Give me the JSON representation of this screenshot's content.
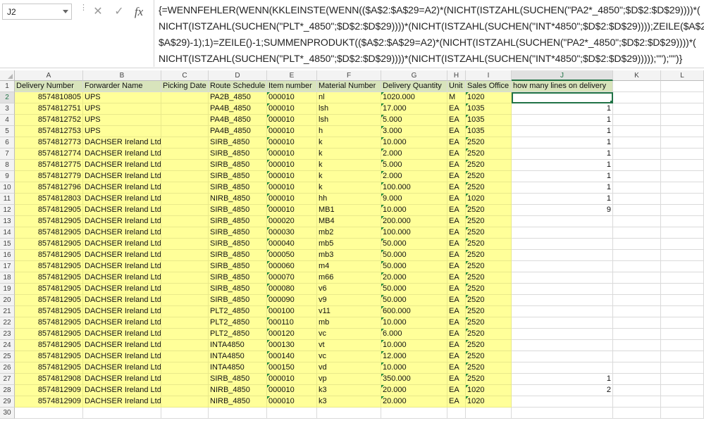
{
  "formula_bar": {
    "name_box": "J2",
    "cancel_symbol": "✕",
    "enter_symbol": "✓",
    "fx_label": "fx",
    "formula_lines": [
      "{=WENNFEHLER(WENN(KKLEINSTE(WENN(($A$2:$A$29=A2)*(NICHT(ISTZAHL(SUCHEN(\"PA2*_4850\";$D$2:$D$29))))*(",
      "NICHT(ISTZAHL(SUCHEN(\"PLT*_4850\";$D$2:$D$29))))*(NICHT(ISTZAHL(SUCHEN(\"INT*4850\";$D$2:$D$29))));ZEILE($A$2:",
      "$A$29)-1);1)=ZEILE()-1;SUMMENPRODUKT(($A$2:$A$29=A2)*(NICHT(ISTZAHL(SUCHEN(\"PA2*_4850\";$D$2:$D$29))))*(",
      "NICHT(ISTZAHL(SUCHEN(\"PLT*_4850\";$D$2:$D$29))))*(NICHT(ISTZAHL(SUCHEN(\"INT*4850\";$D$2:$D$29)))));\"\");\"\")}"
    ]
  },
  "columns": [
    "A",
    "B",
    "C",
    "D",
    "E",
    "F",
    "G",
    "H",
    "I",
    "J",
    "K",
    "L"
  ],
  "headers": [
    "Delivery Number",
    "Forwarder Name",
    "Picking Date",
    "Route Schedule",
    "Item number",
    "Material Number",
    "Delivery Quantity",
    "Unit",
    "Sales Office",
    "how many lines on delivery"
  ],
  "row_numbers": [
    "1",
    "2",
    "3",
    "4",
    "5",
    "6",
    "7",
    "8",
    "9",
    "10",
    "11",
    "12",
    "13",
    "14",
    "15",
    "16",
    "17",
    "18",
    "19",
    "20",
    "21",
    "22",
    "23",
    "24",
    "25",
    "26",
    "27",
    "28",
    "29",
    "30"
  ],
  "rows": [
    [
      "8574810805",
      "UPS",
      "",
      "PA2B_4850",
      "000010",
      "nl",
      "1020.000",
      "M",
      "1020",
      ""
    ],
    [
      "8574812751",
      "UPS",
      "",
      "PA4B_4850",
      "000010",
      "lsh",
      "17.000",
      "EA",
      "1035",
      "1"
    ],
    [
      "8574812752",
      "UPS",
      "",
      "PA4B_4850",
      "000010",
      "lsh",
      "5.000",
      "EA",
      "1035",
      "1"
    ],
    [
      "8574812753",
      "UPS",
      "",
      "PA4B_4850",
      "000010",
      "h",
      "3.000",
      "EA",
      "1035",
      "1"
    ],
    [
      "8574812773",
      "DACHSER Ireland Ltd.",
      "",
      "SIRB_4850",
      "000010",
      "k",
      "10.000",
      "EA",
      "2520",
      "1"
    ],
    [
      "8574812774",
      "DACHSER Ireland Ltd.",
      "",
      "SIRB_4850",
      "000010",
      "k",
      "2.000",
      "EA",
      "2520",
      "1"
    ],
    [
      "8574812775",
      "DACHSER Ireland Ltd.",
      "",
      "SIRB_4850",
      "000010",
      "k",
      "5.000",
      "EA",
      "2520",
      "1"
    ],
    [
      "8574812779",
      "DACHSER Ireland Ltd.",
      "",
      "SIRB_4850",
      "000010",
      "k",
      "2.000",
      "EA",
      "2520",
      "1"
    ],
    [
      "8574812796",
      "DACHSER Ireland Ltd.",
      "",
      "SIRB_4850",
      "000010",
      "k",
      "100.000",
      "EA",
      "2520",
      "1"
    ],
    [
      "8574812803",
      "DACHSER Ireland Ltd.",
      "",
      "NIRB_4850",
      "000010",
      "hh",
      "9.000",
      "EA",
      "1020",
      "1"
    ],
    [
      "8574812905",
      "DACHSER Ireland Ltd.",
      "",
      "SIRB_4850",
      "000010",
      "MB1",
      "10.000",
      "EA",
      "2520",
      "9"
    ],
    [
      "8574812905",
      "DACHSER Ireland Ltd.",
      "",
      "SIRB_4850",
      "000020",
      "MB4",
      "200.000",
      "EA",
      "2520",
      ""
    ],
    [
      "8574812905",
      "DACHSER Ireland Ltd.",
      "",
      "SIRB_4850",
      "000030",
      "mb2",
      "100.000",
      "EA",
      "2520",
      ""
    ],
    [
      "8574812905",
      "DACHSER Ireland Ltd.",
      "",
      "SIRB_4850",
      "000040",
      "mb5",
      "50.000",
      "EA",
      "2520",
      ""
    ],
    [
      "8574812905",
      "DACHSER Ireland Ltd.",
      "",
      "SIRB_4850",
      "000050",
      "mb3",
      "50.000",
      "EA",
      "2520",
      ""
    ],
    [
      "8574812905",
      "DACHSER Ireland Ltd.",
      "",
      "SIRB_4850",
      "000060",
      "m4",
      "50.000",
      "EA",
      "2520",
      ""
    ],
    [
      "8574812905",
      "DACHSER Ireland Ltd.",
      "",
      "SIRB_4850",
      "000070",
      "m66",
      "20.000",
      "EA",
      "2520",
      ""
    ],
    [
      "8574812905",
      "DACHSER Ireland Ltd.",
      "",
      "SIRB_4850",
      "000080",
      "v6",
      "50.000",
      "EA",
      "2520",
      ""
    ],
    [
      "8574812905",
      "DACHSER Ireland Ltd.",
      "",
      "SIRB_4850",
      "000090",
      "v9",
      "50.000",
      "EA",
      "2520",
      ""
    ],
    [
      "8574812905",
      "DACHSER Ireland Ltd.",
      "",
      "PLT2_4850",
      "000100",
      "v11",
      "600.000",
      "EA",
      "2520",
      ""
    ],
    [
      "8574812905",
      "DACHSER Ireland Ltd.",
      "",
      "PLT2_4850",
      "000110",
      "mb",
      "10.000",
      "EA",
      "2520",
      ""
    ],
    [
      "8574812905",
      "DACHSER Ireland Ltd.",
      "",
      "PLT2_4850",
      "000120",
      "vc",
      "6.000",
      "EA",
      "2520",
      ""
    ],
    [
      "8574812905",
      "DACHSER Ireland Ltd.",
      "",
      "INTA4850",
      "000130",
      "vt",
      "10.000",
      "EA",
      "2520",
      ""
    ],
    [
      "8574812905",
      "DACHSER Ireland Ltd.",
      "",
      "INTA4850",
      "000140",
      "vc",
      "12.000",
      "EA",
      "2520",
      ""
    ],
    [
      "8574812905",
      "DACHSER Ireland Ltd.",
      "",
      "INTA4850",
      "000150",
      "vd",
      "10.000",
      "EA",
      "2520",
      ""
    ],
    [
      "8574812908",
      "DACHSER Ireland Ltd.",
      "",
      "SIRB_4850",
      "000010",
      "vp",
      "350.000",
      "EA",
      "2520",
      "1"
    ],
    [
      "8574812909",
      "DACHSER Ireland Ltd.",
      "",
      "NIRB_4850",
      "000010",
      "k3",
      "20.000",
      "EA",
      "1020",
      "2"
    ],
    [
      "8574812909",
      "DACHSER Ireland Ltd.",
      "",
      "NIRB_4850",
      "000010",
      "k3",
      "20.000",
      "EA",
      "1020",
      ""
    ]
  ],
  "selected_cell": "J2",
  "colors": {
    "data_fill": "#ffff99",
    "header_fill": "#d8e4bc",
    "accent": "#217346"
  }
}
